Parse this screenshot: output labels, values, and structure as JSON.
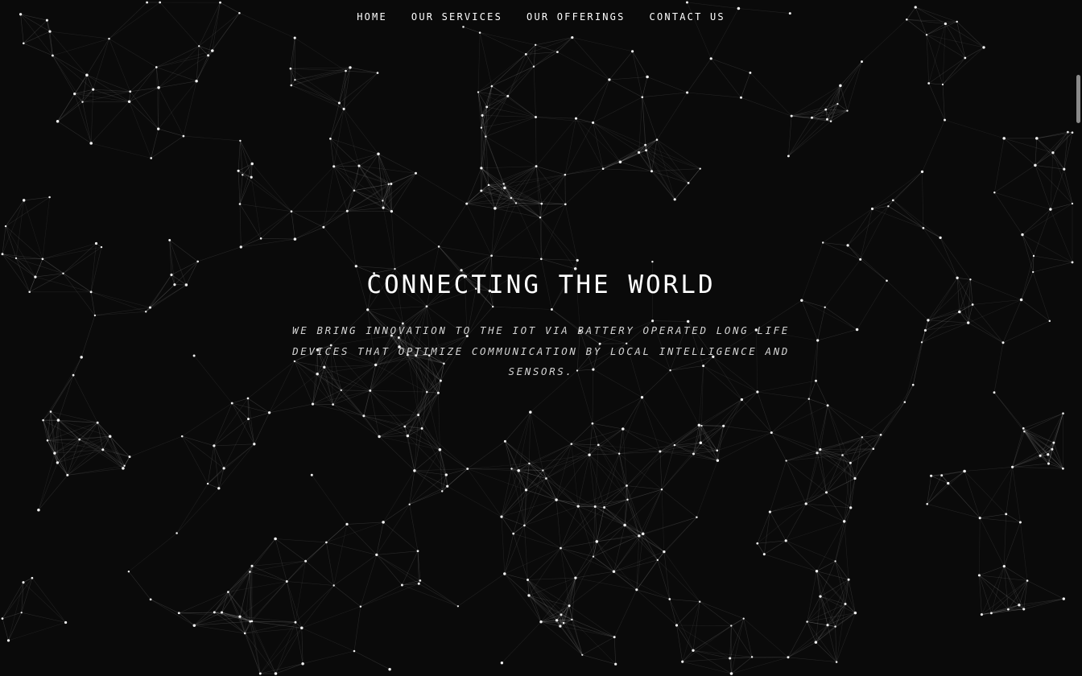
{
  "nav": {
    "items": [
      {
        "label": "HOME"
      },
      {
        "label": "OUR SERVICES"
      },
      {
        "label": "OUR OFFERINGS"
      },
      {
        "label": "CONTACT US"
      }
    ]
  },
  "hero": {
    "title": "CONNECTING THE WORLD",
    "subtitle": "WE BRING INNOVATION TO THE IOT VIA BATTERY OPERATED LONG LIFE DEVICES THAT OPTIMIZE COMMUNICATION BY LOCAL INTELLIGENCE AND SENSORS."
  },
  "colors": {
    "background": "#0a0a0a",
    "text": "#ffffff",
    "subtitle_text": "#d4d4d4",
    "node": "#f2f2f2",
    "link": "rgba(255,255,255,0.22)",
    "scrollbar": "#8a8a8a"
  },
  "background": {
    "type": "particle-network"
  }
}
